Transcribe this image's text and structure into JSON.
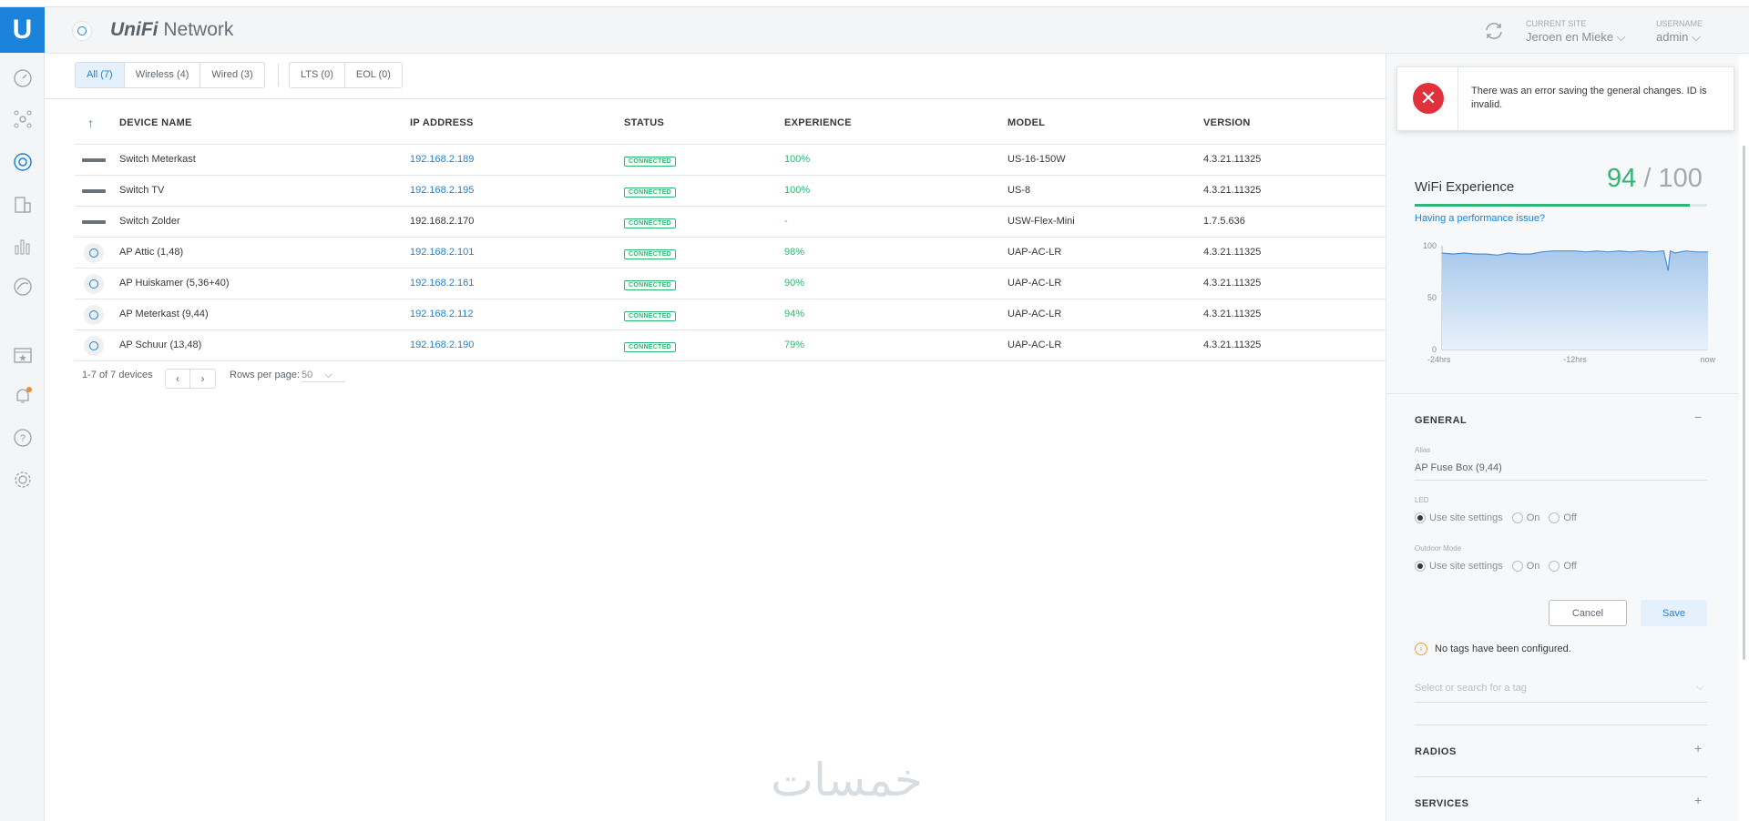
{
  "app": {
    "brand_prefix": "UniFi",
    "brand_name": "Network"
  },
  "header": {
    "site_label": "CURRENT SITE",
    "site_value": "Jeroen en Mieke",
    "user_label": "USERNAME",
    "user_value": "admin"
  },
  "nav": {
    "items": [
      "dashboard-icon",
      "topology-icon",
      "devices-icon",
      "clients-icon",
      "statistics-icon",
      "insights-icon",
      "events-icon",
      "alerts-icon",
      "help-icon",
      "settings-icon"
    ],
    "alert_color": "#f08c2a"
  },
  "filters": {
    "all": "All (7)",
    "wireless": "Wireless (4)",
    "wired": "Wired (3)",
    "lts": "LTS (0)",
    "eol": "EOL (0)"
  },
  "table": {
    "columns": [
      "DEVICE NAME",
      "IP ADDRESS",
      "STATUS",
      "EXPERIENCE",
      "MODEL",
      "VERSION"
    ],
    "rows": [
      {
        "type": "switch",
        "name": "Switch Meterkast",
        "ip": "192.168.2.189",
        "ip_link": true,
        "status": "CONNECTED",
        "experience": "100%",
        "model": "US-16-150W",
        "version": "4.3.21.11325"
      },
      {
        "type": "switch",
        "name": "Switch TV",
        "ip": "192.168.2.195",
        "ip_link": true,
        "status": "CONNECTED",
        "experience": "100%",
        "model": "US-8",
        "version": "4.3.21.11325"
      },
      {
        "type": "switch",
        "name": "Switch Zolder",
        "ip": "192.168.2.170",
        "ip_link": false,
        "status": "CONNECTED",
        "experience": "-",
        "model": "USW-Flex-Mini",
        "version": "1.7.5.636"
      },
      {
        "type": "ap",
        "name": "AP Attic (1,48)",
        "ip": "192.168.2.101",
        "ip_link": true,
        "status": "CONNECTED",
        "experience": "98%",
        "model": "UAP-AC-LR",
        "version": "4.3.21.11325"
      },
      {
        "type": "ap",
        "name": "AP Huiskamer (5,36+40)",
        "ip": "192.168.2.161",
        "ip_link": true,
        "status": "CONNECTED",
        "experience": "90%",
        "model": "UAP-AC-LR",
        "version": "4.3.21.11325"
      },
      {
        "type": "ap",
        "name": "AP Meterkast (9,44)",
        "ip": "192.168.2.112",
        "ip_link": true,
        "status": "CONNECTED",
        "experience": "94%",
        "model": "UAP-AC-LR",
        "version": "4.3.21.11325"
      },
      {
        "type": "ap",
        "name": "AP Schuur (13,48)",
        "ip": "192.168.2.190",
        "ip_link": true,
        "status": "CONNECTED",
        "experience": "79%",
        "model": "UAP-AC-LR",
        "version": "4.3.21.11325"
      }
    ],
    "footer": {
      "range": "1-7 of 7 devices",
      "rows_per_page_label": "Rows per page:",
      "rows_per_page_value": "50"
    }
  },
  "panel": {
    "error": "There was an error saving the general changes. ID is invalid.",
    "wifi_title": "WiFi Experience",
    "wifi_score": "94",
    "wifi_separator": "/",
    "wifi_max": "100",
    "wifi_fraction": 0.94,
    "perf_link": "Having a performance issue?",
    "general_title": "GENERAL",
    "alias_label": "Alias",
    "alias_value": "AP Fuse Box (9,44)",
    "led_label": "LED",
    "outdoor_label": "Outdoor Mode",
    "opt_site": "Use site settings",
    "opt_on": "On",
    "opt_off": "Off",
    "cancel": "Cancel",
    "save": "Save",
    "no_tags": "No tags have been configured.",
    "tag_placeholder": "Select or search for a tag",
    "radios_title": "RADIOS",
    "services_title": "SERVICES"
  },
  "chart_data": {
    "type": "area",
    "title": "",
    "x_ticks": [
      "-24hrs",
      "-12hrs",
      "now"
    ],
    "y_ticks": [
      "100",
      "50",
      "0"
    ],
    "ylim": [
      0,
      100
    ],
    "x": [
      -24,
      -23,
      -22,
      -21,
      -20,
      -19,
      -18,
      -17,
      -16,
      -15,
      -14,
      -13,
      -12,
      -11,
      -10,
      -9,
      -8,
      -7,
      -6,
      -5,
      -4,
      -3.6,
      -3.4,
      -3,
      -2,
      -1,
      0
    ],
    "values": [
      93,
      92,
      93,
      92,
      92,
      91,
      93,
      92,
      92,
      94,
      95,
      95,
      95,
      94,
      95,
      94,
      95,
      94,
      95,
      94,
      95,
      76,
      95,
      93,
      95,
      94,
      94
    ],
    "color": "#4a8fd6"
  },
  "watermark": "خمسات",
  "colors": {
    "accent": "#1b83db",
    "good": "#2fb574",
    "error": "#e0313d",
    "warning": "#e9a23b"
  }
}
